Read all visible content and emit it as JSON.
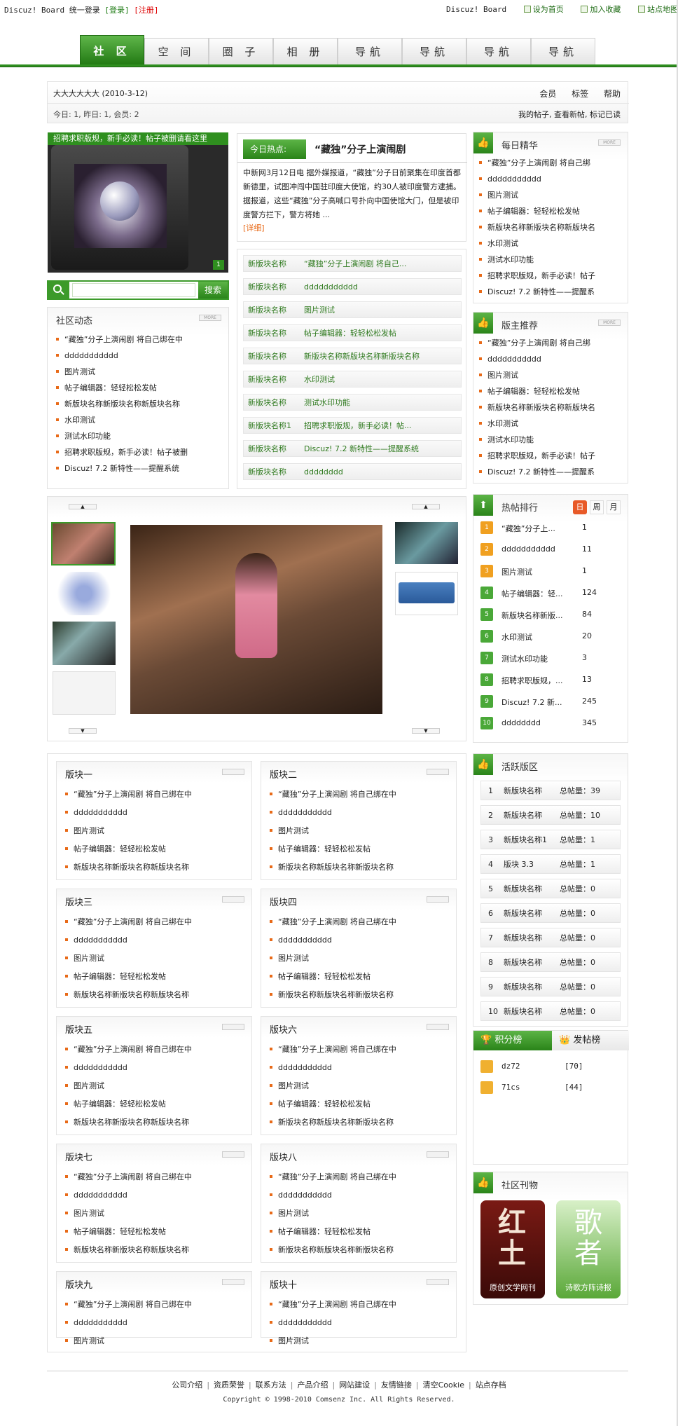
{
  "topbar": {
    "brand": "Discuz! Board 统一登录",
    "login": "[登录]",
    "register": "[注册]",
    "links": [
      "Discuz! Board",
      "设为首页",
      "加入收藏",
      "站点地图"
    ]
  },
  "nav": {
    "tabs": [
      "社 区",
      "空 间",
      "圈 子",
      "相 册",
      "导航",
      "导航",
      "导航",
      "导航"
    ]
  },
  "info": {
    "user": "大大大大大大 (2010-3-12)",
    "stats": "今日: 1, 昨日: 1, 会员: 2",
    "links": [
      "会员",
      "标签",
      "帮助"
    ],
    "links2": "我的帖子, 查看新帖, 标记已读"
  },
  "banner": {
    "caption": "招聘求职版规，新手必读！帖子被删请看这里",
    "badge": "1"
  },
  "search": {
    "placeholder": "",
    "button": "搜索"
  },
  "hot": {
    "tag": "今日热点:",
    "title": "“藏独”分子上演闹剧",
    "body": "中新网3月12日电 据外媒报道，“藏独”分子日前聚集在印度首都新德里，试图冲闯中国驻印度大使馆，约30人被印度警方逮捕。 据报道，这些“藏独”分子高喊口号扑向中国使馆大门，但是被印度警方拦下，警方将她 ...",
    "more": "[详细]"
  },
  "forum_rows": [
    {
      "forum": "新版块名称",
      "topic": "“藏独”分子上演闹剧 将自己..."
    },
    {
      "forum": "新版块名称",
      "topic": "ddddddddddd"
    },
    {
      "forum": "新版块名称",
      "topic": "图片测试"
    },
    {
      "forum": "新版块名称",
      "topic": "帖子编辑器：轻轻松松发帖"
    },
    {
      "forum": "新版块名称",
      "topic": "新版块名称新版块名称新版块名称"
    },
    {
      "forum": "新版块名称",
      "topic": "水印测试"
    },
    {
      "forum": "新版块名称",
      "topic": "测试水印功能"
    },
    {
      "forum": "新版块名称1",
      "topic": "招聘求职版规，新手必读！帖..."
    },
    {
      "forum": "新版块名称",
      "topic": "Discuz! 7.2 新特性——提醒系统"
    },
    {
      "forum": "新版块名称",
      "topic": "dddddddd"
    }
  ],
  "community": {
    "title": "社区动态",
    "more": "MORE",
    "items": [
      "“藏独”分子上演闹剧 将自己绑在中",
      "ddddddddddd",
      "图片测试",
      "帖子编辑器：轻轻松松发帖",
      "新版块名称新版块名称新版块名称",
      "水印测试",
      "测试水印功能",
      "招聘求职版规，新手必读！帖子被删",
      "Discuz! 7.2 新特性——提醒系统"
    ]
  },
  "daily": {
    "title": "每日精华",
    "more": "MORE",
    "items": [
      "“藏独”分子上演闹剧 将自己绑",
      "ddddddddddd",
      "图片测试",
      "帖子编辑器：轻轻松松发帖",
      "新版块名称新版块名称新版块名",
      "水印测试",
      "测试水印功能",
      "招聘求职版规，新手必读！帖子",
      "Discuz! 7.2 新特性——提醒系"
    ]
  },
  "moderator": {
    "title": "版主推荐",
    "more": "MORE",
    "items": [
      "“藏独”分子上演闹剧 将自己绑",
      "ddddddddddd",
      "图片测试",
      "帖子编辑器：轻轻松松发帖",
      "新版块名称新版块名称新版块名",
      "水印测试",
      "测试水印功能",
      "招聘求职版规，新手必读！帖子",
      "Discuz! 7.2 新特性——提醒系"
    ]
  },
  "hotrank": {
    "title": "热帖排行",
    "tabs": [
      "日",
      "周",
      "月"
    ],
    "rows": [
      {
        "n": "1",
        "t": "“藏独”分子上...",
        "c": "1"
      },
      {
        "n": "2",
        "t": "ddddddddddd",
        "c": "11"
      },
      {
        "n": "3",
        "t": "图片测试",
        "c": "1"
      },
      {
        "n": "4",
        "t": "帖子编辑器：轻...",
        "c": "124"
      },
      {
        "n": "5",
        "t": "新版块名称新版...",
        "c": "84"
      },
      {
        "n": "6",
        "t": "水印测试",
        "c": "20"
      },
      {
        "n": "7",
        "t": "测试水印功能",
        "c": "3"
      },
      {
        "n": "8",
        "t": "招聘求职版规，...",
        "c": "13"
      },
      {
        "n": "9",
        "t": "Discuz! 7.2 新...",
        "c": "245"
      },
      {
        "n": "10",
        "t": "dddddddd",
        "c": "345"
      }
    ]
  },
  "active": {
    "title": "活跃版区",
    "rows": [
      {
        "n": "1",
        "name": "新版块名称",
        "posts": "总帖量：39"
      },
      {
        "n": "2",
        "name": "新版块名称",
        "posts": "总帖量：10"
      },
      {
        "n": "3",
        "name": "新版块名称1",
        "posts": "总帖量：1"
      },
      {
        "n": "4",
        "name": "版块 3.3",
        "posts": "总帖量：1"
      },
      {
        "n": "5",
        "name": "新版块名称",
        "posts": "总帖量：0"
      },
      {
        "n": "6",
        "name": "新版块名称",
        "posts": "总帖量：0"
      },
      {
        "n": "7",
        "name": "新版块名称",
        "posts": "总帖量：0"
      },
      {
        "n": "8",
        "name": "新版块名称",
        "posts": "总帖量：0"
      },
      {
        "n": "9",
        "name": "新版块名称",
        "posts": "总帖量：0"
      },
      {
        "n": "10",
        "name": "新版块名称",
        "posts": "总帖量：0"
      }
    ]
  },
  "credits": {
    "tab1": "积分榜",
    "tab2": "发帖榜",
    "rows": [
      {
        "name": "dz72",
        "score": "[70]"
      },
      {
        "name": "71cs",
        "score": "[44]"
      }
    ]
  },
  "publications": {
    "title": "社区刊物",
    "items": [
      {
        "big": "红土",
        "small": "原创文学网刊"
      },
      {
        "big": "歌者",
        "small": "诗歌方阵诗报"
      }
    ]
  },
  "sections": [
    {
      "title": "版块一"
    },
    {
      "title": "版块二"
    },
    {
      "title": "版块三"
    },
    {
      "title": "版块四"
    },
    {
      "title": "版块五"
    },
    {
      "title": "版块六"
    },
    {
      "title": "版块七"
    },
    {
      "title": "版块八"
    },
    {
      "title": "版块九"
    },
    {
      "title": "版块十"
    }
  ],
  "section_items": [
    "“藏独”分子上演闹剧 将自己绑在中",
    "ddddddddddd",
    "图片测试",
    "帖子编辑器：轻轻松松发帖",
    "新版块名称新版块名称新版块名称"
  ],
  "footer": {
    "links": [
      "公司介绍",
      "资质荣誉",
      "联系方法",
      "产品介绍",
      "网站建设",
      "友情链接",
      "清空Cookie",
      "站点存档"
    ],
    "copyright": "Copyright © 1998-2010 Comsenz Inc. All Rights Reserved."
  },
  "colors": {
    "green": "#2f8f1f",
    "orange": "#e86a18"
  }
}
